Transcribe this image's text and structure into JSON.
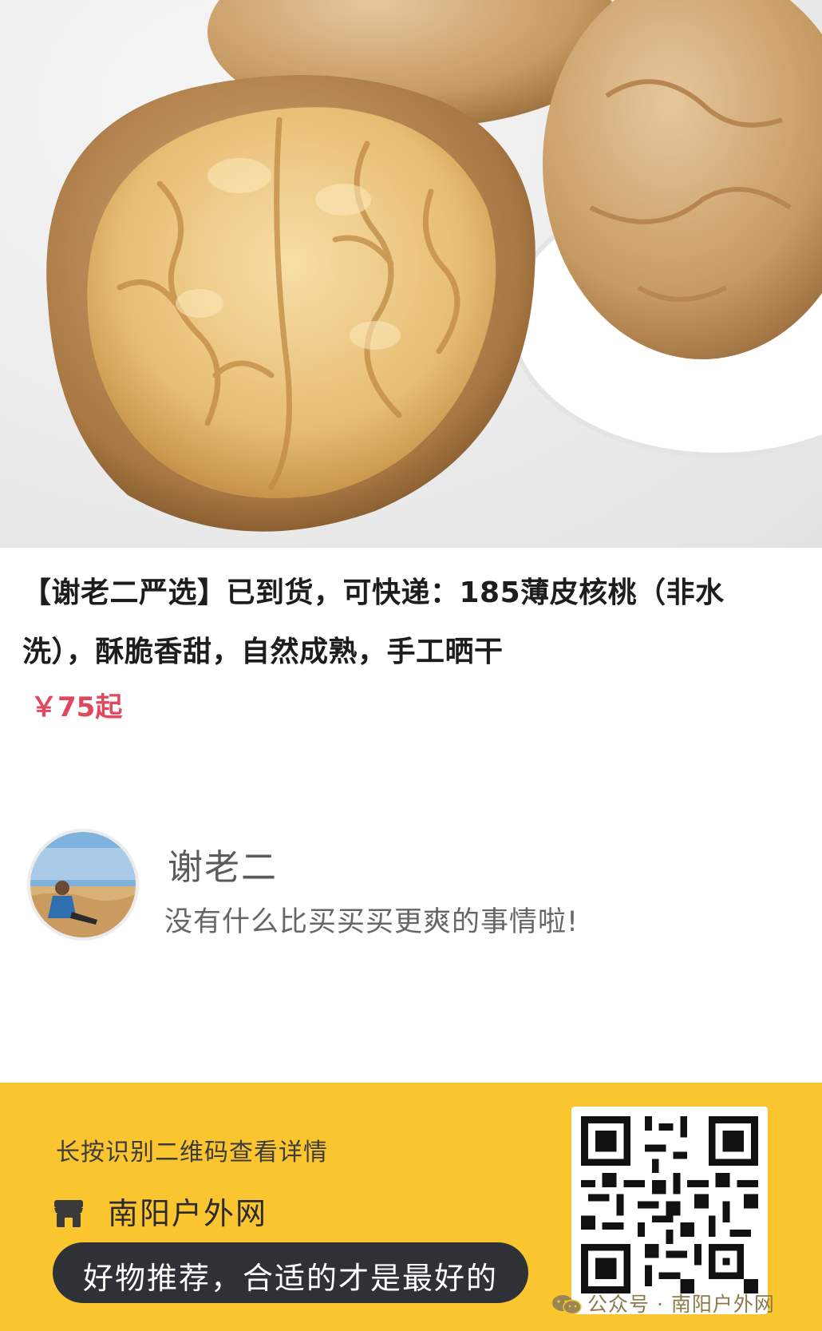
{
  "product": {
    "title": "【谢老二严选】已到货，可快递：185薄皮核桃（非水洗），酥脆香甜，自然成熟，手工晒干",
    "price": "￥75起"
  },
  "seller": {
    "name": "谢老二",
    "slogan": "没有什么比买买买更爽的事情啦!"
  },
  "footer": {
    "hint": "长按识别二维码查看详情",
    "store_name": "南阳户外网",
    "slogan": "好物推荐，合适的才是最好的",
    "watermark": "公众号 · 南阳户外网"
  },
  "colors": {
    "price": "#e0485d",
    "footer_bg": "#fbc530",
    "pill_bg": "#2e3136"
  },
  "icons": {
    "store": "store-icon",
    "watermark": "wechat-icon"
  }
}
